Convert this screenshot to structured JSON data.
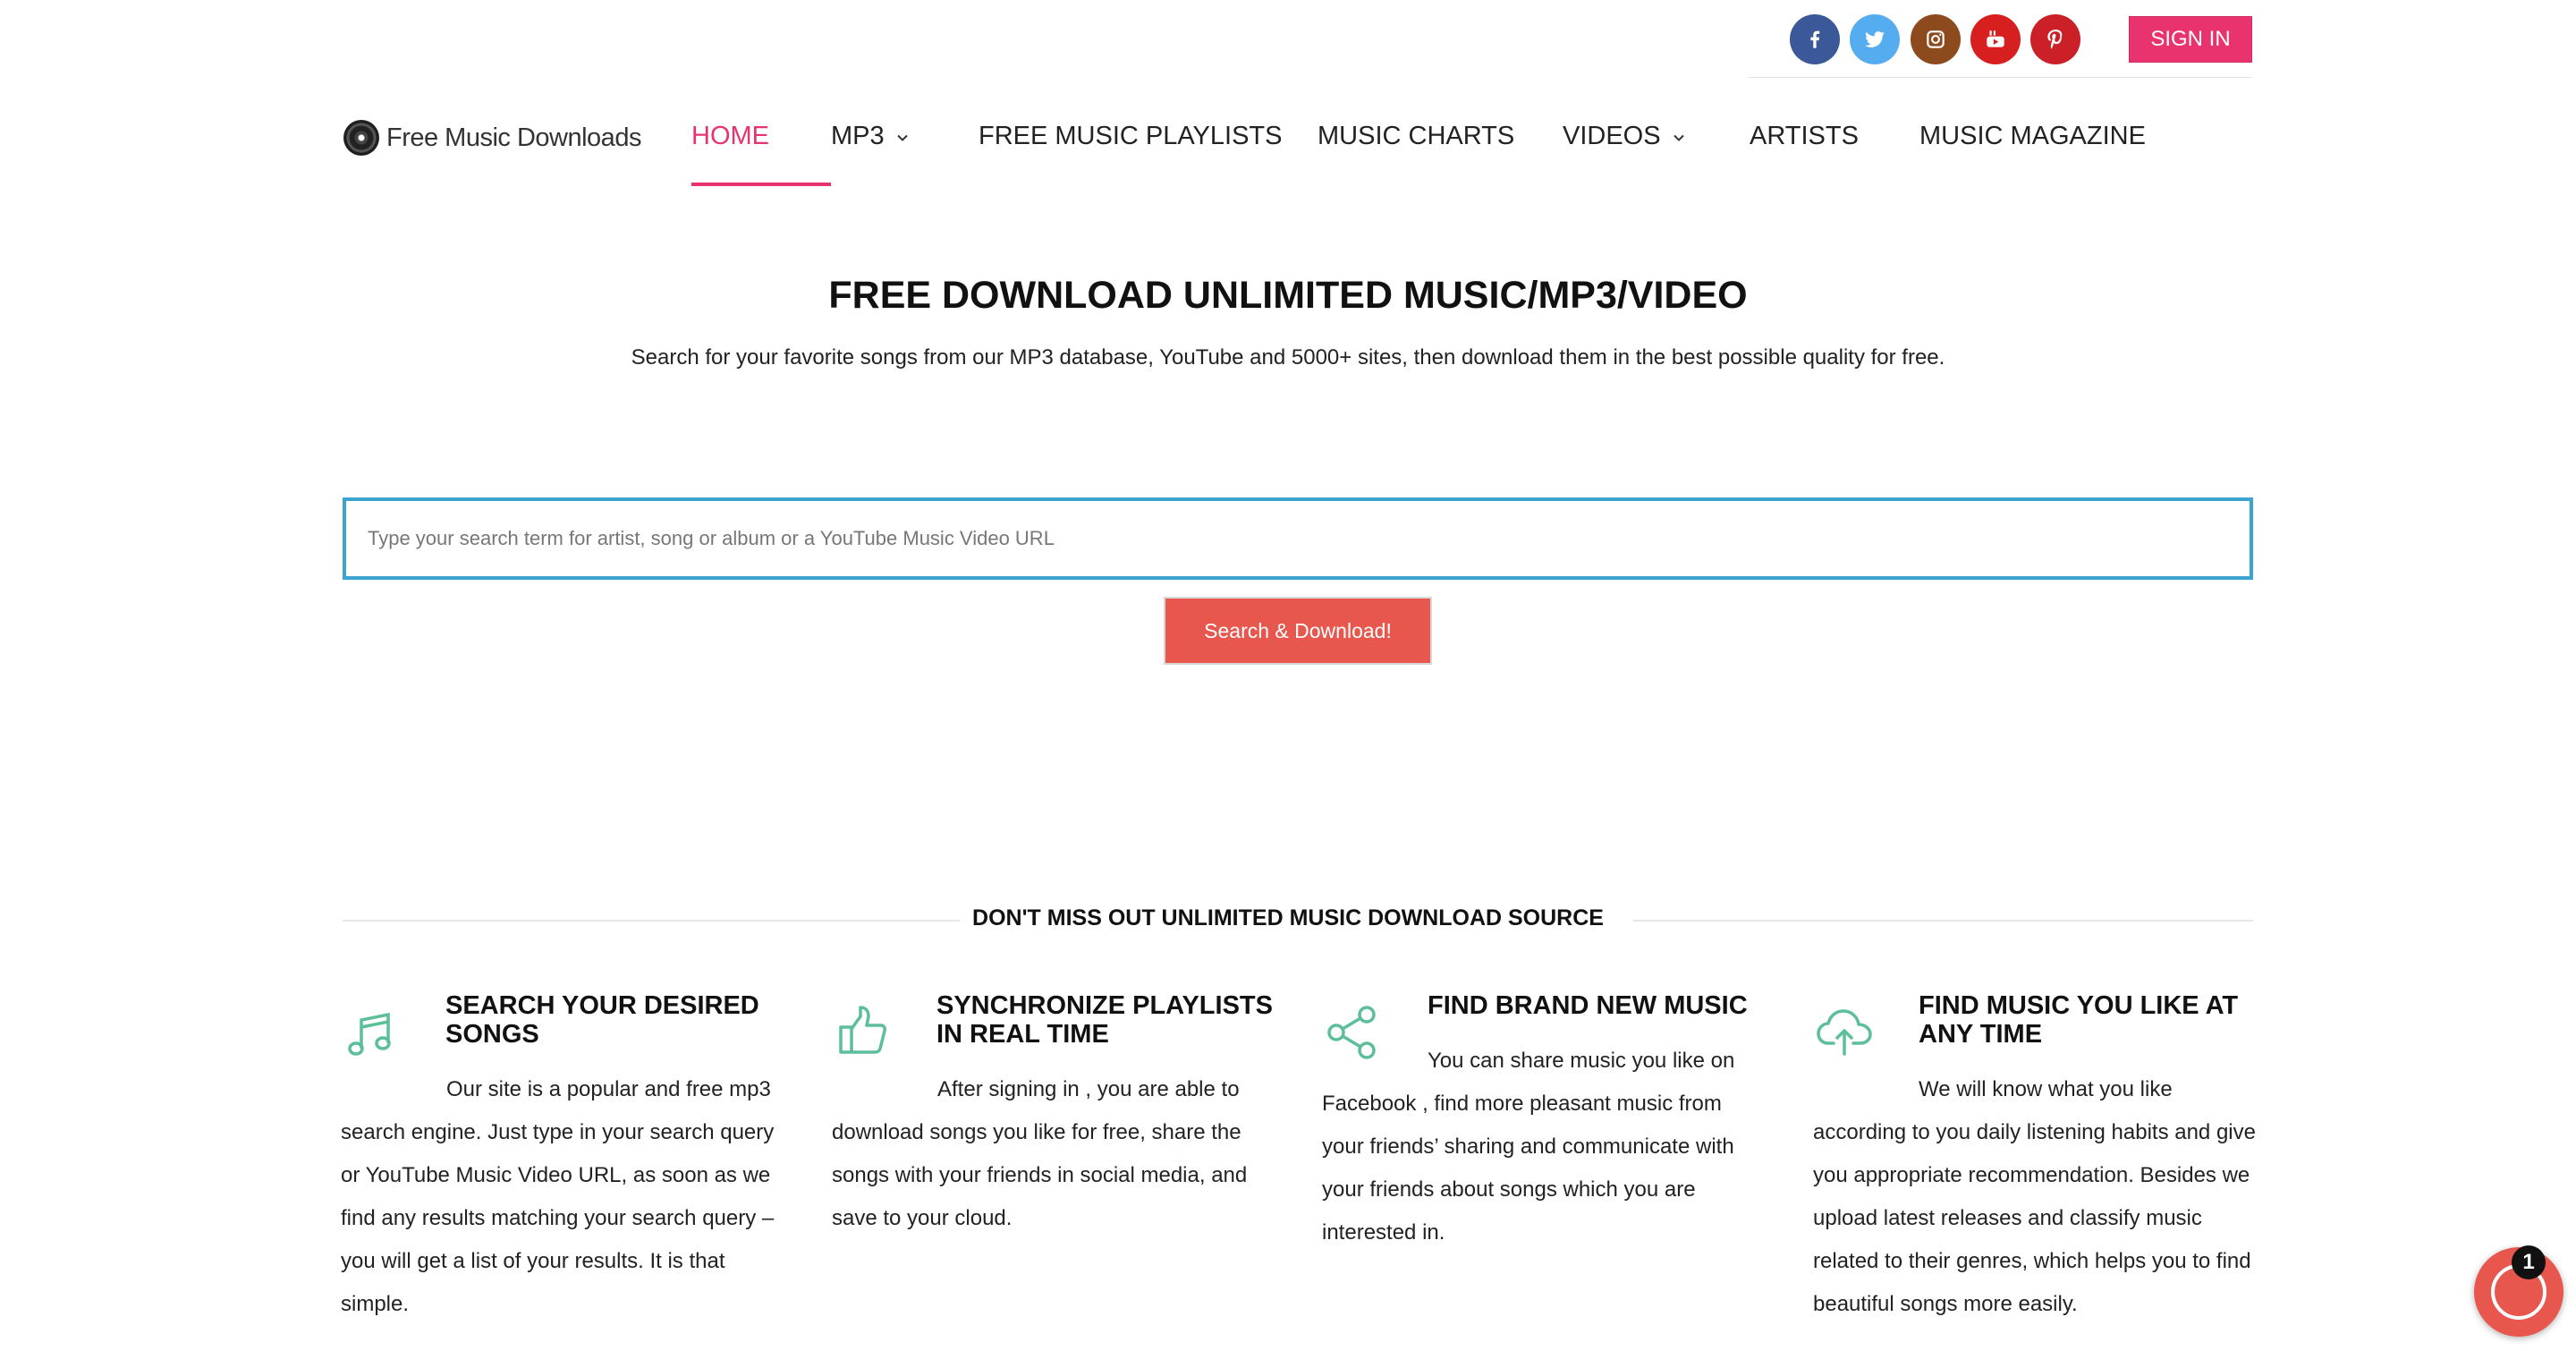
{
  "social": {
    "links": [
      {
        "name": "facebook",
        "icon": "facebook-icon",
        "color": "#3b5998"
      },
      {
        "name": "twitter",
        "icon": "twitter-icon",
        "color": "#55acee"
      },
      {
        "name": "instagram",
        "icon": "instagram-icon",
        "color": "#8d4a1c"
      },
      {
        "name": "youtube",
        "icon": "youtube-icon",
        "color": "#d71f1f"
      },
      {
        "name": "pinterest",
        "icon": "pinterest-icon",
        "color": "#cb2027"
      }
    ],
    "signin_label": "SIGN IN"
  },
  "header": {
    "logo_text": "Free Music Downloads",
    "nav": [
      {
        "label": "HOME",
        "active": true
      },
      {
        "label": "MP3",
        "dropdown": true
      },
      {
        "label": "FREE MUSIC PLAYLISTS"
      },
      {
        "label": "MUSIC CHARTS"
      },
      {
        "label": "VIDEOS",
        "dropdown": true
      },
      {
        "label": "ARTISTS"
      },
      {
        "label": "MUSIC MAGAZINE"
      }
    ]
  },
  "hero": {
    "title": "FREE DOWNLOAD UNLIMITED MUSIC/MP3/VIDEO",
    "subtitle": "Search for your favorite songs from our MP3 database, YouTube and 5000+ sites, then download them in the best possible quality for free.",
    "search_placeholder": "Type your search term for artist, song or album or a YouTube Music Video URL",
    "search_value": "",
    "button_label": "Search & Download!"
  },
  "features": {
    "heading": "DON'T MISS OUT UNLIMITED MUSIC DOWNLOAD SOURCE",
    "items": [
      {
        "icon": "music-note-icon",
        "title": "SEARCH YOUR DESIRED SONGS",
        "text": "Our site is a popular and free mp3 search engine. Just type in your search query or YouTube Music Video URL, as soon as we find any results matching your search query – you will get a list of your results. It is that simple."
      },
      {
        "icon": "thumbs-up-icon",
        "title": "SYNCHRONIZE PLAYLISTS  IN REAL TIME",
        "text": "After signing in , you are able to download songs you like for free, share the songs with your friends in social media, and save to your cloud."
      },
      {
        "icon": "share-icon",
        "title": "FIND BRAND NEW MUSIC",
        "text": "You can share music you like on Facebook , find more pleasant music from your friends’ sharing and communicate with your friends about songs which you are interested in."
      },
      {
        "icon": "cloud-upload-icon",
        "title": "FIND MUSIC YOU LIKE AT ANY TIME",
        "text": "We will know what you like according to you daily listening habits and give you appropriate recommendation. Besides we upload latest releases and classify music related to their genres, which helps you to find beautiful songs more easily."
      }
    ]
  },
  "chat": {
    "badge_count": "1",
    "icon": "chat-icon"
  },
  "colors": {
    "accent": "#e8336f",
    "button": "#e7574e",
    "search_border": "#3ba5cf",
    "icon_green": "#5cbf9a"
  }
}
